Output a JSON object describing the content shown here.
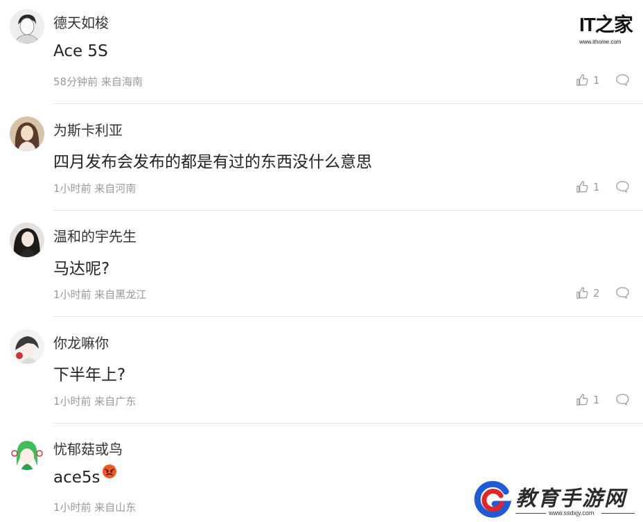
{
  "brand": {
    "ithome_mark": "IT之家",
    "ithome_url": "www.ithome.com"
  },
  "comments": [
    {
      "username": "德天如梭",
      "content": "Ace 5S",
      "meta": "58分钟前 来自海南",
      "likes": "1",
      "avatar_icon": "sketch-boy-avatar"
    },
    {
      "username": "为斯卡利亚",
      "content": "四月发布会发布的都是有过的东西没什么意思",
      "meta": "1小时前 来自河南",
      "likes": "1",
      "avatar_icon": "girl-photo-avatar"
    },
    {
      "username": "温和的宇先生",
      "content": "马达呢?",
      "meta": "1小时前 来自黑龙江",
      "likes": "2",
      "avatar_icon": "woman-photo-avatar"
    },
    {
      "username": "你龙嘛你",
      "content": "下半年上?",
      "meta": "1小时前 来自广东",
      "likes": "1",
      "avatar_icon": "anime-avatar"
    },
    {
      "username": "忧郁菇或鸟",
      "content": "ace5s",
      "content_emoji": "angry-face-emoji",
      "meta": "1小时前 来自山东",
      "likes": "",
      "avatar_icon": "green-cartoon-avatar"
    }
  ],
  "watermark": {
    "name": "教育手游网",
    "site": "www.ssdxjy.com"
  },
  "colors": {
    "meta_text": "#999999",
    "divider": "#e6e6e6",
    "watermark_blue": "#1e5bd6",
    "watermark_red": "#e0262b"
  }
}
